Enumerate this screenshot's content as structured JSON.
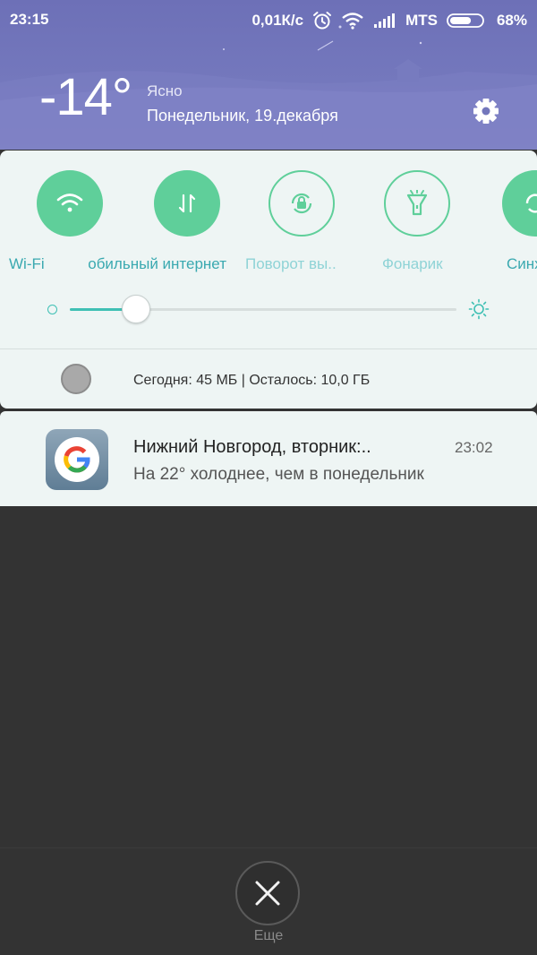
{
  "status_bar": {
    "time": "23:15",
    "net_speed": "0,01К/с",
    "carrier": "MTS",
    "battery": "68%",
    "battery_level": 0.68
  },
  "weather": {
    "temperature": "-14°",
    "condition": "Ясно",
    "date": "Понедельник, 19.декабря"
  },
  "toggles": [
    {
      "label": "Wi-Fi",
      "icon": "wifi-icon",
      "on": true
    },
    {
      "label": "Мобильный интернет",
      "icon": "mobile-data-icon",
      "on": true
    },
    {
      "label": "Поворот вы..",
      "icon": "rotation-lock-icon",
      "on": false
    },
    {
      "label": "Фонарик",
      "icon": "flashlight-icon",
      "on": false
    },
    {
      "label": "Синхронизация",
      "icon": "sync-icon",
      "on": true
    }
  ],
  "brightness": {
    "level": 0.17
  },
  "data_usage": {
    "text": "Сегодня: 45 МБ | Осталось: 10,0 ГБ"
  },
  "notification": {
    "app_icon": "google-icon",
    "title": "Нижний Новгород, вторник:..",
    "time": "23:02",
    "text": "На 22° холоднее, чем в понедельник"
  },
  "bottom": {
    "close_icon": "close-icon",
    "more_label": "Еще"
  },
  "colors": {
    "header": "#7377bc",
    "accent": "#5fcf9a",
    "panel": "#eef5f4",
    "background": "#333333"
  }
}
